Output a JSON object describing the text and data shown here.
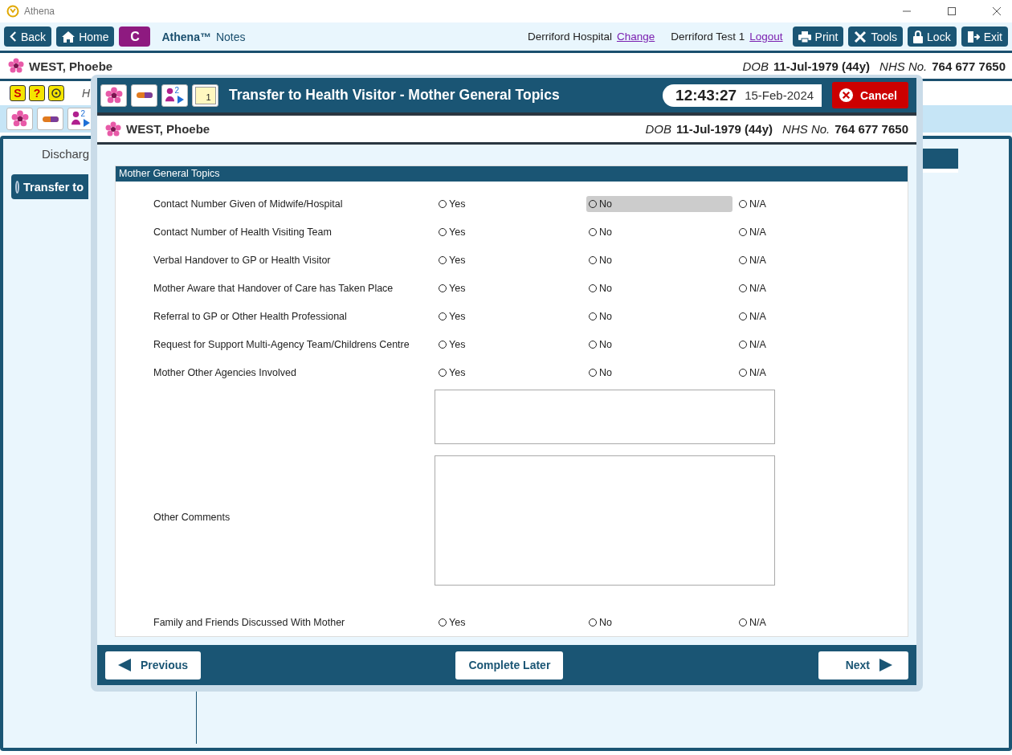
{
  "window": {
    "title": "Athena"
  },
  "toolbar": {
    "back": "Back",
    "home": "Home",
    "badge": "C",
    "brand": "Athena™",
    "product": "Notes",
    "hospital": "Derriford Hospital",
    "change_link": "Change",
    "user": "Derriford Test 1",
    "logout_link": "Logout",
    "buttons": [
      {
        "label": "Print"
      },
      {
        "label": "Tools"
      },
      {
        "label": "Lock"
      },
      {
        "label": "Exit"
      }
    ]
  },
  "patient": {
    "name": "WEST, Phoebe",
    "dob_label": "DOB",
    "dob": "11-Jul-1979 (44y)",
    "nhs_label": "NHS No.",
    "nhs": "764 677 7650"
  },
  "alert_row": {
    "icons": [
      {
        "kind": "glyph",
        "glyph": "S"
      },
      {
        "kind": "glyph",
        "glyph": "?"
      },
      {
        "kind": "target"
      }
    ],
    "text": "H"
  },
  "icon_row": [
    {
      "kind": "flower"
    },
    {
      "kind": "pill"
    },
    {
      "kind": "person",
      "count": "2"
    }
  ],
  "sidebar": {
    "heading": "Discharg",
    "items": [
      {
        "label": "Transfer to",
        "selected": true
      }
    ]
  },
  "dialog": {
    "icons": [
      {
        "kind": "flower"
      },
      {
        "kind": "pill"
      },
      {
        "kind": "person",
        "count": "2"
      },
      {
        "kind": "notepad",
        "count": "1"
      }
    ],
    "title": "Transfer to Health Visitor - Mother General Topics",
    "time": "12:43:27",
    "date": "15-Feb-2024",
    "cancel": "Cancel",
    "patient": {
      "name": "WEST, Phoebe",
      "dob_label": "DOB",
      "dob": "11-Jul-1979 (44y)",
      "nhs_label": "NHS No.",
      "nhs": "764 677 7650"
    },
    "section_title": "Mother General Topics",
    "questions": [
      {
        "kind": "radio",
        "label": "Contact Number Given of Midwife/Hospital",
        "options": [
          {
            "label": "Yes",
            "selected": false,
            "highlighted": false
          },
          {
            "label": "No",
            "selected": false,
            "highlighted": true
          },
          {
            "label": "N/A",
            "selected": false,
            "highlighted": false
          }
        ]
      },
      {
        "kind": "radio",
        "label": "Contact Number of Health Visiting Team",
        "options": [
          {
            "label": "Yes",
            "selected": false,
            "highlighted": false
          },
          {
            "label": "No",
            "selected": false,
            "highlighted": false
          },
          {
            "label": "N/A",
            "selected": false,
            "highlighted": false
          }
        ]
      },
      {
        "kind": "radio",
        "label": "Verbal Handover to GP or Health Visitor",
        "options": [
          {
            "label": "Yes",
            "selected": false,
            "highlighted": false
          },
          {
            "label": "No",
            "selected": false,
            "highlighted": false
          },
          {
            "label": "N/A",
            "selected": false,
            "highlighted": false
          }
        ]
      },
      {
        "kind": "radio",
        "label": "Mother Aware that Handover of Care has Taken Place",
        "options": [
          {
            "label": "Yes",
            "selected": false,
            "highlighted": false
          },
          {
            "label": "No",
            "selected": false,
            "highlighted": false
          },
          {
            "label": "N/A",
            "selected": false,
            "highlighted": false
          }
        ]
      },
      {
        "kind": "radio",
        "label": "Referral to GP or Other Health Professional",
        "options": [
          {
            "label": "Yes",
            "selected": false,
            "highlighted": false
          },
          {
            "label": "No",
            "selected": false,
            "highlighted": false
          },
          {
            "label": "N/A",
            "selected": false,
            "highlighted": false
          }
        ]
      },
      {
        "kind": "radio",
        "label": "Request for Support Multi-Agency Team/Childrens Centre",
        "options": [
          {
            "label": "Yes",
            "selected": false,
            "highlighted": false
          },
          {
            "label": "No",
            "selected": false,
            "highlighted": false
          },
          {
            "label": "N/A",
            "selected": false,
            "highlighted": false
          }
        ]
      },
      {
        "kind": "radio",
        "label": "Mother Other Agencies Involved",
        "options": [
          {
            "label": "Yes",
            "selected": false,
            "highlighted": false
          },
          {
            "label": "No",
            "selected": false,
            "highlighted": false
          },
          {
            "label": "N/A",
            "selected": false,
            "highlighted": false
          }
        ]
      },
      {
        "kind": "textarea"
      },
      {
        "kind": "textarea",
        "label": "Other Comments"
      },
      {
        "kind": "radio",
        "label": "Family and Friends Discussed With Mother",
        "options": [
          {
            "label": "Yes",
            "selected": false,
            "highlighted": false
          },
          {
            "label": "No",
            "selected": false,
            "highlighted": false
          },
          {
            "label": "N/A",
            "selected": false,
            "highlighted": false
          }
        ]
      }
    ],
    "footer": {
      "previous": "Previous",
      "complete_later": "Complete Later",
      "next": "Next"
    }
  }
}
